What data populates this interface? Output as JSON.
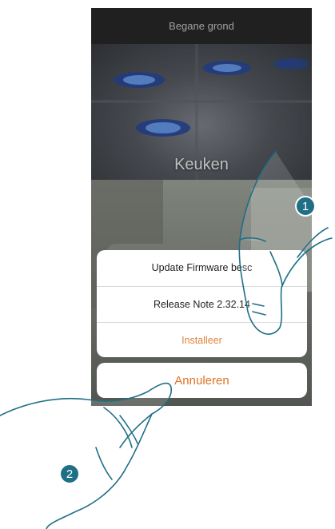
{
  "header": {
    "title": "Begane grond"
  },
  "rooms": [
    {
      "label": "Keuken"
    }
  ],
  "action_sheet": {
    "title": "Update Firmware besc",
    "release_note": "Release Note 2.32.14",
    "install_label": "Installeer",
    "cancel_label": "Annuleren"
  },
  "callouts": {
    "step1": "1",
    "step2": "2"
  },
  "colors": {
    "accent": "#e07124",
    "badge": "#1f6f86",
    "topbar": "#2b2b2b"
  }
}
